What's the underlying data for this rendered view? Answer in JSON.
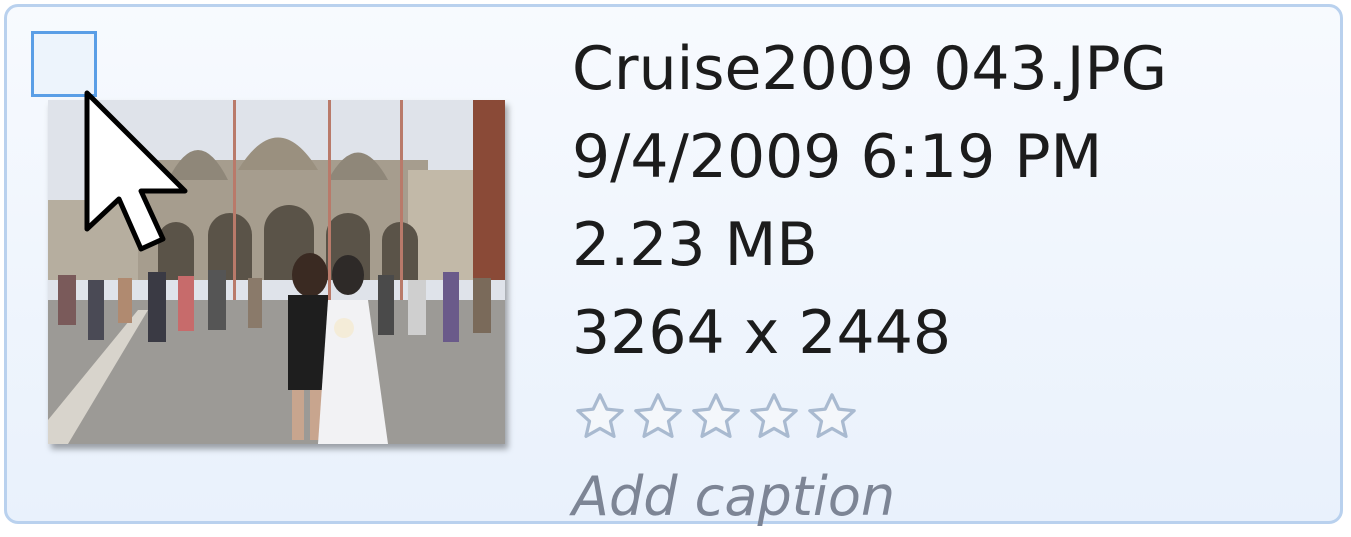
{
  "file": {
    "name": "Cruise2009 043.JPG",
    "date": "9/4/2009 6:19 PM",
    "size": "2.23 MB",
    "dimensions": "3264 x 2448",
    "rating": 0,
    "rating_max": 5,
    "caption_placeholder": "Add caption"
  },
  "colors": {
    "selection_border": "#b9d1ee",
    "checkbox_border": "#5a9ee6",
    "caption_text": "#7d8595",
    "star_outline": "#a9bad0"
  },
  "icons": {
    "checkbox": "empty-checkbox",
    "cursor": "mouse-pointer-icon",
    "rating": "star-outline-icon"
  }
}
